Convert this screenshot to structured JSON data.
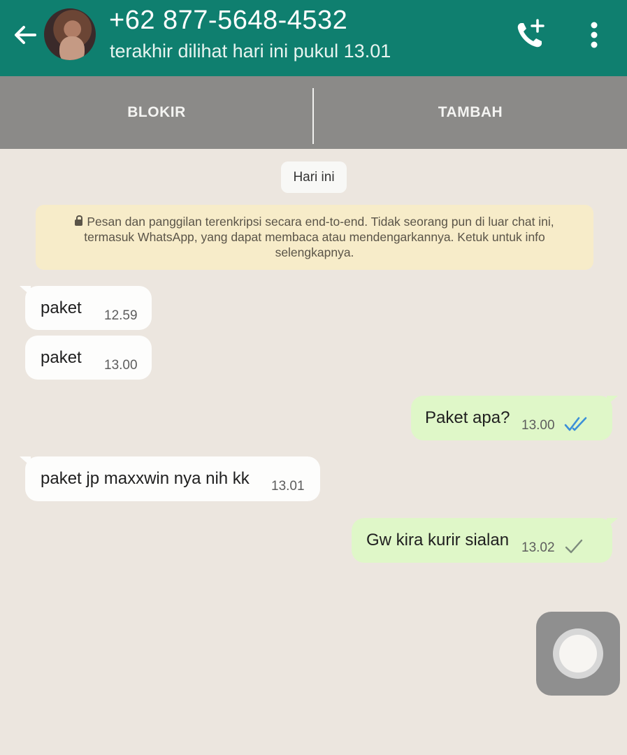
{
  "header": {
    "contact_name": "+62 877-5648-4532",
    "last_seen": "terakhir dilihat hari ini pukul 13.01",
    "icons": [
      "back-arrow-icon",
      "avatar",
      "add-call-icon",
      "more-vertical-icon"
    ],
    "bg_color": "#0f7f6f"
  },
  "actions": {
    "block_label": "BLOKIR",
    "add_label": "TAMBAH"
  },
  "chat": {
    "day_label": "Hari ini",
    "encryption_notice": "Pesan dan panggilan terenkripsi secara end-to-end. Tidak seorang pun di luar chat ini, termasuk WhatsApp, yang dapat membaca atau mendengarkannya. Ketuk untuk info selengkapnya.",
    "messages": [
      {
        "direction": "in",
        "text": "paket",
        "time": "12.59"
      },
      {
        "direction": "in",
        "text": "paket",
        "time": "13.00"
      },
      {
        "direction": "out",
        "text": "Paket apa?",
        "time": "13.00",
        "status": "read"
      },
      {
        "direction": "in",
        "text": "paket jp maxxwin nya nih kk",
        "time": "13.01"
      },
      {
        "direction": "out",
        "text": "Gw kira kurir sialan",
        "time": "13.02",
        "status": "sent"
      }
    ]
  },
  "colors": {
    "incoming_bubble": "#fdfdfc",
    "outgoing_bubble": "#dff7c8",
    "read_ticks": "#3b8fd8",
    "notice_bg": "#f7ecc9"
  }
}
